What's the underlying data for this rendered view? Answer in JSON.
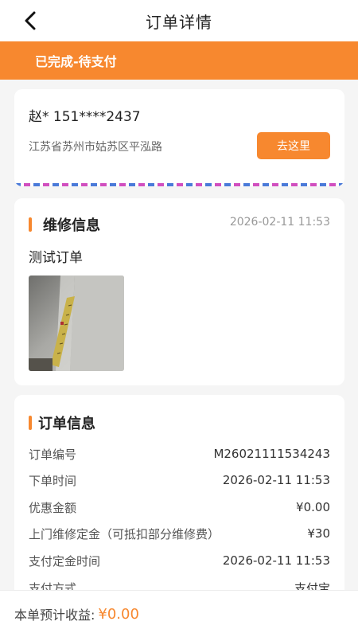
{
  "nav": {
    "title": "订单详情",
    "back_icon": "chevron-left-icon"
  },
  "status": {
    "text": "已完成-待支付",
    "color": "#f7882f"
  },
  "contact": {
    "name_phone": "赵* 151****2437",
    "address": "江苏省苏州市姑苏区平泓路",
    "go_button": "去这里"
  },
  "repair": {
    "title": "维修信息",
    "time": "2026-02-11 11:53",
    "description": "测试订单"
  },
  "order": {
    "title": "订单信息",
    "rows": [
      {
        "label": "订单编号",
        "value": "M26021111534243"
      },
      {
        "label": "下单时间",
        "value": "2026-02-11 11:53"
      },
      {
        "label": "优惠金额",
        "value": "¥0.00"
      },
      {
        "label": "上门维修定金（可抵扣部分维修费）",
        "value": "¥30"
      },
      {
        "label": "支付定金时间",
        "value": "2026-02-11 11:53"
      },
      {
        "label": "支付方式",
        "value": "支付宝"
      }
    ]
  },
  "footer": {
    "label": "本单预计收益:",
    "amount": "¥0.00"
  }
}
